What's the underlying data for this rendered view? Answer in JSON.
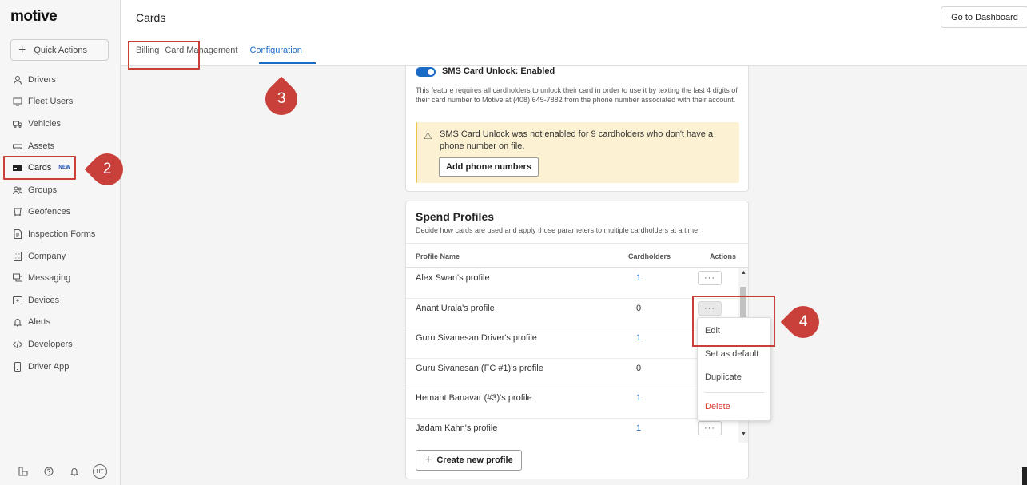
{
  "brand": {
    "logo": "motive"
  },
  "sidebar": {
    "quick_actions": "Quick Actions",
    "items": [
      {
        "label": "Drivers",
        "icon": "person-icon"
      },
      {
        "label": "Fleet Users",
        "icon": "monitor-icon"
      },
      {
        "label": "Vehicles",
        "icon": "truck-icon"
      },
      {
        "label": "Assets",
        "icon": "trailer-icon"
      },
      {
        "label": "Cards",
        "icon": "card-icon",
        "badge": "NEW"
      },
      {
        "label": "Groups",
        "icon": "group-icon"
      },
      {
        "label": "Geofences",
        "icon": "geofence-icon"
      },
      {
        "label": "Inspection Forms",
        "icon": "document-icon"
      },
      {
        "label": "Company",
        "icon": "building-icon"
      },
      {
        "label": "Messaging",
        "icon": "chat-icon"
      },
      {
        "label": "Devices",
        "icon": "device-icon"
      },
      {
        "label": "Alerts",
        "icon": "bell-icon"
      },
      {
        "label": "Developers",
        "icon": "code-icon"
      },
      {
        "label": "Driver App",
        "icon": "phone-icon"
      }
    ],
    "avatar_initials": "HT"
  },
  "header": {
    "title": "Cards",
    "dashboard_button": "Go to Dashboard",
    "tabs": [
      {
        "label": "Billing"
      },
      {
        "label": "Card Management"
      },
      {
        "label": "Configuration",
        "active": true
      }
    ]
  },
  "sms": {
    "title": "SMS Card Unlock: Enabled",
    "description": "This feature requires all cardholders to unlock their card in order to use it by texting the last 4 digits of their card number to Motive at (408) 645-7882 from the phone number associated with their account.",
    "warning": "SMS Card Unlock was not enabled for 9 cardholders who don't have a phone number on file.",
    "warning_button": "Add phone numbers"
  },
  "spend_profiles": {
    "title": "Spend Profiles",
    "subtitle": "Decide how cards are used and apply those parameters to multiple cardholders at a time.",
    "columns": {
      "name": "Profile Name",
      "cardholders": "Cardholders",
      "actions": "Actions"
    },
    "rows": [
      {
        "name": "Alex Swan's profile",
        "cardholders": "1"
      },
      {
        "name": "Anant Urala's profile",
        "cardholders": "0"
      },
      {
        "name": "Guru Sivanesan Driver's profile",
        "cardholders": "1"
      },
      {
        "name": "Guru Sivanesan (FC #1)'s profile",
        "cardholders": "0"
      },
      {
        "name": "Hemant Banavar (#3)'s profile",
        "cardholders": "1"
      },
      {
        "name": "Jadam Kahn's profile",
        "cardholders": "1"
      }
    ],
    "more_label": "···",
    "create_button": "Create new profile"
  },
  "dropdown": {
    "items": [
      "Edit",
      "Set as default",
      "Duplicate",
      "Delete"
    ]
  },
  "callouts": [
    "2",
    "3",
    "4"
  ],
  "colors": {
    "accent": "#1a6cc7",
    "highlight": "#c9403a",
    "warning_bg": "#fdf1d4",
    "danger": "#d9342b"
  }
}
